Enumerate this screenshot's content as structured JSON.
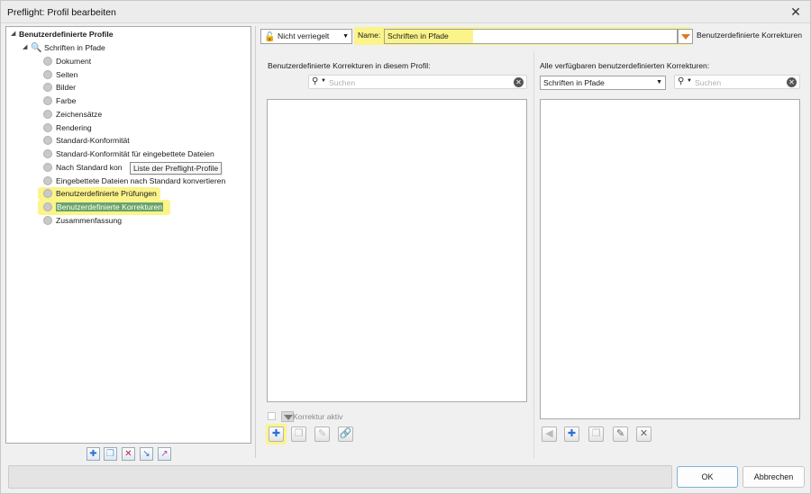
{
  "window": {
    "title": "Preflight: Profil bearbeiten",
    "close_glyph": "✕"
  },
  "tree": {
    "root_label": "Benutzerdefinierte Profile",
    "profile_label": "Schriften in Pfade",
    "items": [
      "Dokument",
      "Seiten",
      "Bilder",
      "Farbe",
      "Zeichensätze",
      "Rendering",
      "Standard-Konformität",
      "Standard-Konformität für eingebettete Dateien",
      "Nach Standard kon",
      "Eingebettete Dateien nach Standard konvertieren",
      "Benutzerdefinierte Prüfungen",
      "Benutzerdefinierte Korrekturen",
      "Zusammenfassung"
    ],
    "selected_item": "Benutzerdefinierte Korrekturen",
    "tooltip": "Liste der Preflight-Profile"
  },
  "tree_toolbar": {
    "icons": [
      "add-profile-icon",
      "duplicate-profile-icon",
      "delete-profile-icon",
      "import-profile-icon",
      "export-profile-icon"
    ]
  },
  "top": {
    "lock_dropdown": "Nicht verriegelt",
    "name_label": "Name:",
    "name_value": "Schriften in Pfade",
    "category_label": "Benutzerdefinierte Korrekturen"
  },
  "left_list": {
    "heading": "Benutzerdefinierte Korrekturen in diesem Profil:",
    "search_placeholder": "Suchen",
    "checkbox_label": "Korrektur aktiv"
  },
  "right_list": {
    "heading": "Alle verfügbaren benutzerdefinierten Korrekturen:",
    "filter_value": "Schriften in Pfade",
    "search_placeholder": "Suchen"
  },
  "colors": {
    "highlight": "#fbf48a",
    "selection": "#6aa36a",
    "accent_orange": "#e07818"
  },
  "buttons": {
    "ok": "OK",
    "cancel": "Abbrechen"
  }
}
